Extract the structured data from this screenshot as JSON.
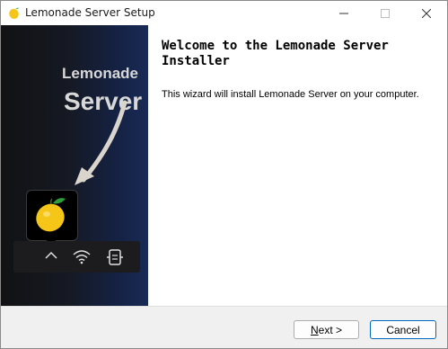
{
  "window": {
    "title": "Lemonade Server Setup",
    "icon": "lemon-icon",
    "controls": [
      "minimize-icon",
      "maximize-icon",
      "close-icon"
    ]
  },
  "banner": {
    "brand_line1": "Lemonade",
    "brand_line2": "Server",
    "taskbar_icons": [
      "chevron-up-icon",
      "wifi-icon",
      "tray-icon"
    ],
    "popup_icon": "lemon-icon"
  },
  "content": {
    "heading": "Welcome to the Lemonade Server Installer",
    "body": "This wizard will install Lemonade Server on your computer."
  },
  "footer": {
    "next_access_key": "N",
    "next_label_rest": "ext >",
    "cancel_label": "Cancel"
  },
  "colors": {
    "banner_dark": "#121214",
    "banner_blue": "#182a56",
    "accent": "#0067c0",
    "lemon": "#f5c518"
  }
}
